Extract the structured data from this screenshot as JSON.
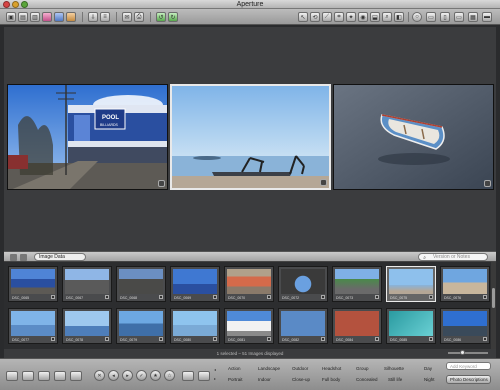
{
  "window": {
    "title": "Aperture"
  },
  "browser": {
    "view_select": "Image Data",
    "search_placeholder": "Version or Notes"
  },
  "thumbnails": [
    {
      "label": "DSC_0065"
    },
    {
      "label": "DSC_0067"
    },
    {
      "label": "DSC_0068"
    },
    {
      "label": "DSC_0069"
    },
    {
      "label": "DSC_0070"
    },
    {
      "label": "DSC_0072"
    },
    {
      "label": "DSC_0073"
    },
    {
      "label": "DSC_0075"
    },
    {
      "label": "DSC_0076"
    },
    {
      "label": "DSC_0077"
    },
    {
      "label": "DSC_0078"
    },
    {
      "label": "DSC_0079"
    },
    {
      "label": "DSC_0080"
    },
    {
      "label": "DSC_0081"
    },
    {
      "label": "DSC_0082"
    },
    {
      "label": "DSC_0084"
    },
    {
      "label": "DSC_0085"
    },
    {
      "label": "DSC_0086"
    }
  ],
  "status": {
    "text": "1 selected – 51 Images displayed"
  },
  "keywords": {
    "row1": [
      "Action",
      "Landscape",
      "Outdoor",
      "Headshot",
      "Group",
      "Silhouette",
      "Day"
    ],
    "row2": [
      "Portrait",
      "Indoor",
      "Close-up",
      "Full body",
      "Concealed",
      "Still life",
      "Night"
    ],
    "input_placeholder": "Add Keyword",
    "preset_label": "Photo Descriptions"
  }
}
